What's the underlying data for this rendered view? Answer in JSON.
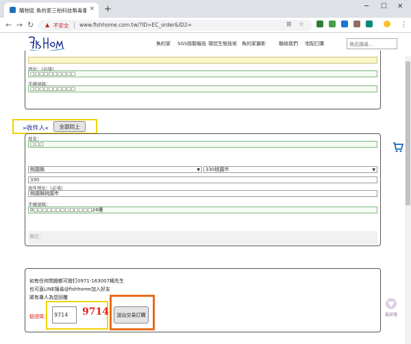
{
  "browser": {
    "tab_title": "購物區 魚的家三柏科技無毒養殖",
    "tab_close": "×",
    "new_tab": "+",
    "window_controls": {
      "minimize": "─",
      "maximize": "☐",
      "close": "✕"
    },
    "nav": {
      "back": "←",
      "forward": "→",
      "reload": "↻"
    },
    "security_label": "不安全",
    "url": "www.fishhome.com.tw/?ID=EC_order&ID2=",
    "menu_dots": "⋮"
  },
  "site": {
    "logo_text": "fishhome",
    "nav_items": [
      "魚的家",
      "SGS檢驗報告",
      "環控生態技術",
      "魚的家攝影",
      "聯絡我們",
      "宅配訂購"
    ],
    "search_placeholder": "商品搜尋..."
  },
  "sender": {
    "address_label": "地址：(必填)",
    "address_value": "□□□□□□□□□□",
    "phone_label": "手機號碼：",
    "phone_value": "□□□□□□□□□□"
  },
  "recipient": {
    "section_prefix": "»",
    "section_title": "收件人",
    "section_suffix": "«",
    "same_as_button": "全部同上",
    "name_label": "姓名：",
    "name_value": "□□□",
    "county_select": "桃園縣",
    "district_select": "330桃園市",
    "zip_value": "330",
    "address_label": "收件地址：(必填)",
    "address_value": "桃園縣桃園市",
    "phone_label": "手機號碼：",
    "phone_value": "0□□□□□□□□□□□□□24樓",
    "note_placeholder": "備註："
  },
  "footer": {
    "line1": "如有任何問題都可撥打0971-163007楊先生",
    "line2": "也可直LINE搜尋@fishhome加入好友",
    "line3": "將有專人為您回覆",
    "captcha_label": "驗證碼：",
    "captcha_input": "9714",
    "captcha_code": "9714",
    "submit_button": "送出交易訂購"
  },
  "cart_icon": "cart-icon",
  "watermark_text": "鑫部落",
  "colors": {
    "accent_red": "#e0241b",
    "highlight_yellow": "#f2d200",
    "highlight_orange": "#e86a1a",
    "section_blue": "#1a2a8c"
  }
}
